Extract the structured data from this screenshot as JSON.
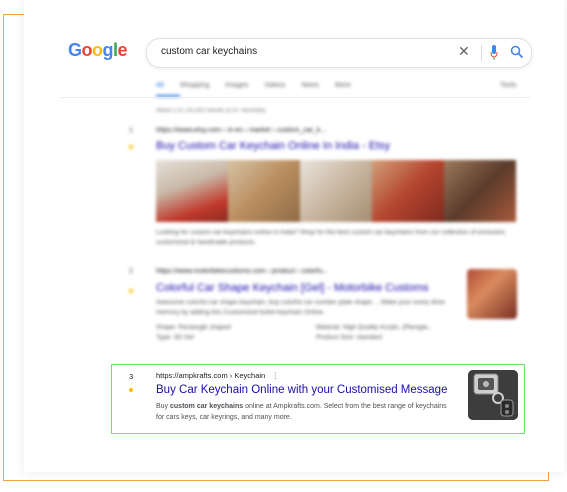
{
  "logo": {
    "letters": [
      "G",
      "o",
      "o",
      "g",
      "l",
      "e"
    ],
    "colors": [
      "#4285f4",
      "#ea4335",
      "#fbbc05",
      "#4285f4",
      "#34a853",
      "#ea4335"
    ]
  },
  "search": {
    "query": "custom car keychains"
  },
  "tabs": {
    "items": [
      "All",
      "Shopping",
      "Images",
      "Videos",
      "News",
      "More"
    ],
    "tools": "Tools"
  },
  "stats": "About 2,47,00,000 results (0.47 seconds)",
  "results": [
    {
      "rank": "1",
      "url": "https://www.etsy.com › in-en › market › custom_car_k...",
      "title": "Buy Custom Car Keychain Online In India - Etsy",
      "snippet": "Looking for custom car keychains online in India? Shop for the best custom car keychains from our collection of exclusive, customized & handmade products."
    },
    {
      "rank": "2",
      "url": "https://www.motorbikecustoms.com › product › colorfu...",
      "title": "Colorful Car Shape Keychain [Gel] - Motorbike Customs",
      "snippet": "Awesome colorful car shape keychain, buy colorful car number plate shape ... Make your every drive memory by adding this Customized bullet keychain Online.",
      "meta_left": "Shape: Rectangle shaped",
      "meta_left2": "Type: 3D Gel",
      "meta_right": "Material: High Quality Acrylic, (Plexigla...",
      "meta_right2": "Product Size: standard"
    },
    {
      "rank": "3",
      "url": "https://ampkrafts.com › Keychain",
      "url_menu": "⋮",
      "title": "Buy Car Keychain Online with your Customised Message",
      "snippet_pre": "Buy ",
      "snippet_bold": "custom car keychains",
      "snippet_post": " online at Ampkrafts.com. Select from the best range of keychains for cars keys, car keyrings, and many more."
    }
  ],
  "colors": {
    "link": "#1a0dab",
    "highlight_border": "#6fe46f",
    "frame": "#f0a14a",
    "accent": "#1a73e8"
  }
}
